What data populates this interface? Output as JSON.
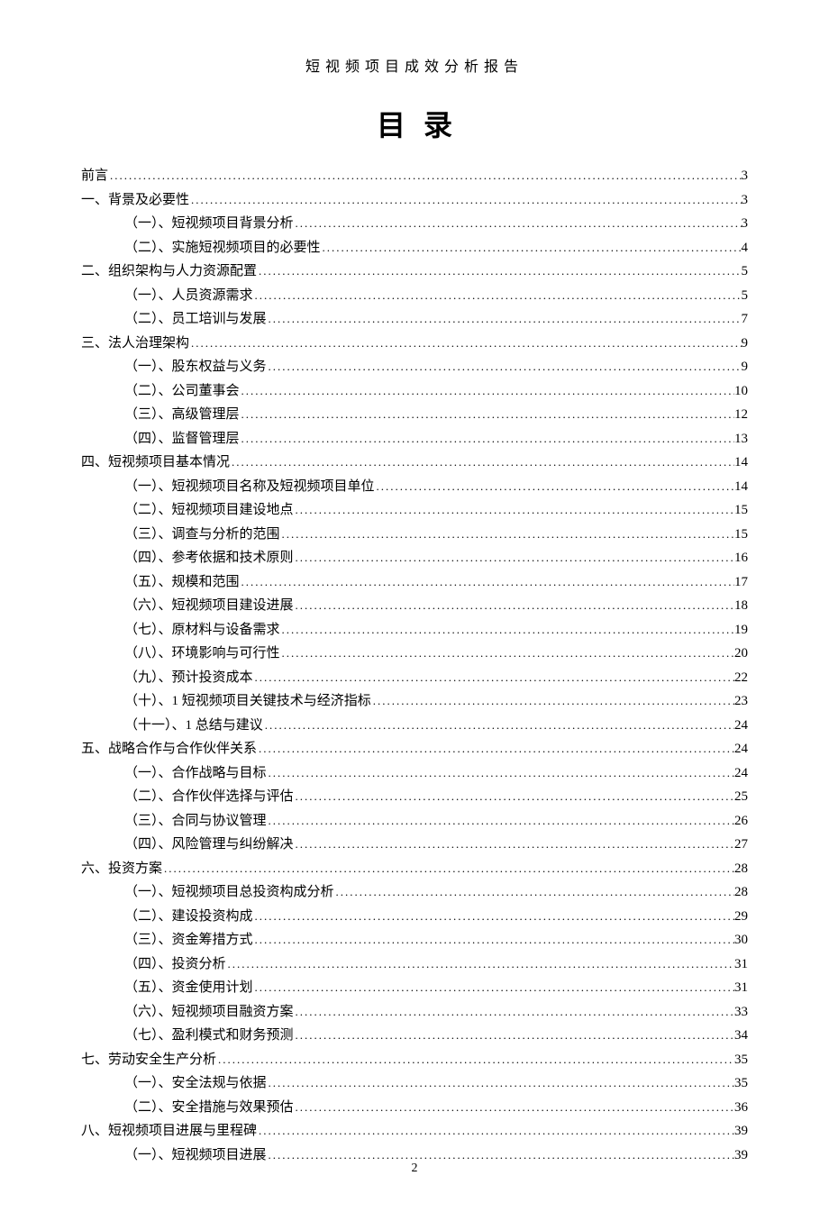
{
  "header": "短视频项目成效分析报告",
  "toc_title": "目录",
  "page_number": "2",
  "entries": [
    {
      "level": 0,
      "label": "前言",
      "page": "3"
    },
    {
      "level": 0,
      "label": "一、背景及必要性",
      "page": "3"
    },
    {
      "level": 1,
      "label": "（一）、短视频项目背景分析",
      "page": "3"
    },
    {
      "level": 1,
      "label": "（二）、实施短视频项目的必要性",
      "page": "4"
    },
    {
      "level": 0,
      "label": "二、组织架构与人力资源配置",
      "page": "5"
    },
    {
      "level": 1,
      "label": "（一）、人员资源需求",
      "page": "5"
    },
    {
      "level": 1,
      "label": "（二）、员工培训与发展",
      "page": "7"
    },
    {
      "level": 0,
      "label": "三、法人治理架构 ",
      "page": "9"
    },
    {
      "level": 1,
      "label": "（一）、股东权益与义务",
      "page": "9"
    },
    {
      "level": 1,
      "label": "（二）、公司董事会",
      "page": "10"
    },
    {
      "level": 1,
      "label": "（三）、高级管理层",
      "page": "12"
    },
    {
      "level": 1,
      "label": "（四）、监督管理层",
      "page": "13"
    },
    {
      "level": 0,
      "label": "四、短视频项目基本情况",
      "page": "14"
    },
    {
      "level": 1,
      "label": "（一）、短视频项目名称及短视频项目单位",
      "page": "14"
    },
    {
      "level": 1,
      "label": "（二）、短视频项目建设地点",
      "page": "15"
    },
    {
      "level": 1,
      "label": "（三）、调查与分析的范围",
      "page": "15"
    },
    {
      "level": 1,
      "label": "（四）、参考依据和技术原则",
      "page": "16"
    },
    {
      "level": 1,
      "label": "（五）、规模和范围",
      "page": "17"
    },
    {
      "level": 1,
      "label": "（六）、短视频项目建设进展",
      "page": "18"
    },
    {
      "level": 1,
      "label": "（七）、原材料与设备需求",
      "page": "19"
    },
    {
      "level": 1,
      "label": "（八）、环境影响与可行性",
      "page": "20"
    },
    {
      "level": 1,
      "label": "（九）、预计投资成本",
      "page": "22"
    },
    {
      "level": 1,
      "label": "（十）、1 短视频项目关键技术与经济指标",
      "page": "23"
    },
    {
      "level": 1,
      "label": "（十一）、1 总结与建议",
      "page": "24"
    },
    {
      "level": 0,
      "label": "五、战略合作与合作伙伴关系",
      "page": "24"
    },
    {
      "level": 1,
      "label": "（一）、合作战略与目标",
      "page": "24"
    },
    {
      "level": 1,
      "label": "（二）、合作伙伴选择与评估",
      "page": "25"
    },
    {
      "level": 1,
      "label": "（三）、合同与协议管理",
      "page": "26"
    },
    {
      "level": 1,
      "label": "（四）、风险管理与纠纷解决",
      "page": "27"
    },
    {
      "level": 0,
      "label": "六、投资方案 ",
      "page": "28"
    },
    {
      "level": 1,
      "label": "（一）、短视频项目总投资构成分析",
      "page": "28"
    },
    {
      "level": 1,
      "label": "（二）、建设投资构成",
      "page": "29"
    },
    {
      "level": 1,
      "label": "（三）、资金筹措方式",
      "page": "30"
    },
    {
      "level": 1,
      "label": "（四）、投资分析 ",
      "page": "31"
    },
    {
      "level": 1,
      "label": "（五）、资金使用计划",
      "page": "31"
    },
    {
      "level": 1,
      "label": "（六）、短视频项目融资方案",
      "page": "33"
    },
    {
      "level": 1,
      "label": "（七）、盈利模式和财务预测",
      "page": "34"
    },
    {
      "level": 0,
      "label": "七、劳动安全生产分析",
      "page": "35"
    },
    {
      "level": 1,
      "label": "（一）、安全法规与依据",
      "page": "35"
    },
    {
      "level": 1,
      "label": "（二）、安全措施与效果预估",
      "page": "36"
    },
    {
      "level": 0,
      "label": "八、短视频项目进展与里程碑",
      "page": "39"
    },
    {
      "level": 1,
      "label": "（一）、短视频项目进展",
      "page": "39"
    }
  ]
}
